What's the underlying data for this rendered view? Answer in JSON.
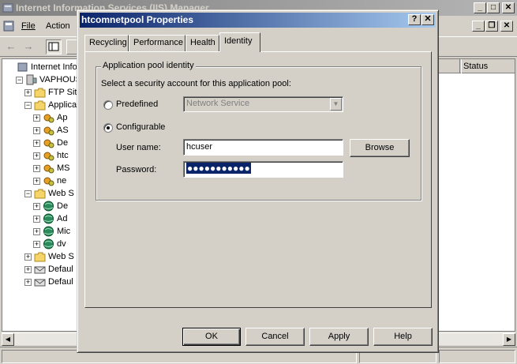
{
  "app": {
    "title": "Internet Information Services (IIS) Manager",
    "menu": [
      "File",
      "Action"
    ],
    "list_column": "Status",
    "tree": [
      {
        "label": "Internet Information",
        "indent": 0,
        "icon": "iis-icon",
        "expander": ""
      },
      {
        "label": "VAPHOUSE",
        "indent": 1,
        "icon": "computer-icon",
        "expander": "−"
      },
      {
        "label": "FTP Sit",
        "indent": 2,
        "icon": "folder-icon",
        "expander": "+"
      },
      {
        "label": "Applica",
        "indent": 2,
        "icon": "folder-icon",
        "expander": "−"
      },
      {
        "label": "Ap",
        "indent": 3,
        "icon": "app-pool-icon",
        "expander": "+"
      },
      {
        "label": "AS",
        "indent": 3,
        "icon": "app-pool-icon",
        "expander": "+"
      },
      {
        "label": "De",
        "indent": 3,
        "icon": "app-pool-icon",
        "expander": "+"
      },
      {
        "label": "htc",
        "indent": 3,
        "icon": "app-pool-icon",
        "expander": "+"
      },
      {
        "label": "MS",
        "indent": 3,
        "icon": "app-pool-icon",
        "expander": "+"
      },
      {
        "label": "ne",
        "indent": 3,
        "icon": "app-pool-icon",
        "expander": "+"
      },
      {
        "label": "Web S",
        "indent": 2,
        "icon": "folder-icon",
        "expander": "−"
      },
      {
        "label": "De",
        "indent": 3,
        "icon": "globe-icon",
        "expander": "+"
      },
      {
        "label": "Ad",
        "indent": 3,
        "icon": "globe-icon",
        "expander": "+"
      },
      {
        "label": "Mic",
        "indent": 3,
        "icon": "globe-icon",
        "expander": "+"
      },
      {
        "label": "dv",
        "indent": 3,
        "icon": "globe-icon",
        "expander": "+"
      },
      {
        "label": "Web S",
        "indent": 2,
        "icon": "folder-icon",
        "expander": "+"
      },
      {
        "label": "Defaul",
        "indent": 2,
        "icon": "smtp-icon",
        "expander": "+"
      },
      {
        "label": "Defaul",
        "indent": 2,
        "icon": "smtp-icon",
        "expander": "+"
      }
    ]
  },
  "dialog": {
    "title": "htcomnetpool Properties",
    "title_help": "?",
    "title_close": "✕",
    "tabs": [
      "Recycling",
      "Performance",
      "Health",
      "Identity"
    ],
    "active_tab": "Identity",
    "group_title": "Application pool identity",
    "instruction": "Select a security account for this application pool:",
    "predefined_label": "Predefined",
    "predefined_value": "Network Service",
    "predefined_checked": false,
    "configurable_label": "Configurable",
    "configurable_checked": true,
    "username_label": "User name:",
    "username_value": "hcuser",
    "password_label": "Password:",
    "password_value": "●●●●●●●●●●●",
    "browse_label": "Browse",
    "ok_label": "OK",
    "cancel_label": "Cancel",
    "apply_label": "Apply",
    "help_label": "Help"
  },
  "colors": {
    "active_title": "#0a246a",
    "inactive_title": "#808080",
    "face": "#d4d0c8"
  }
}
